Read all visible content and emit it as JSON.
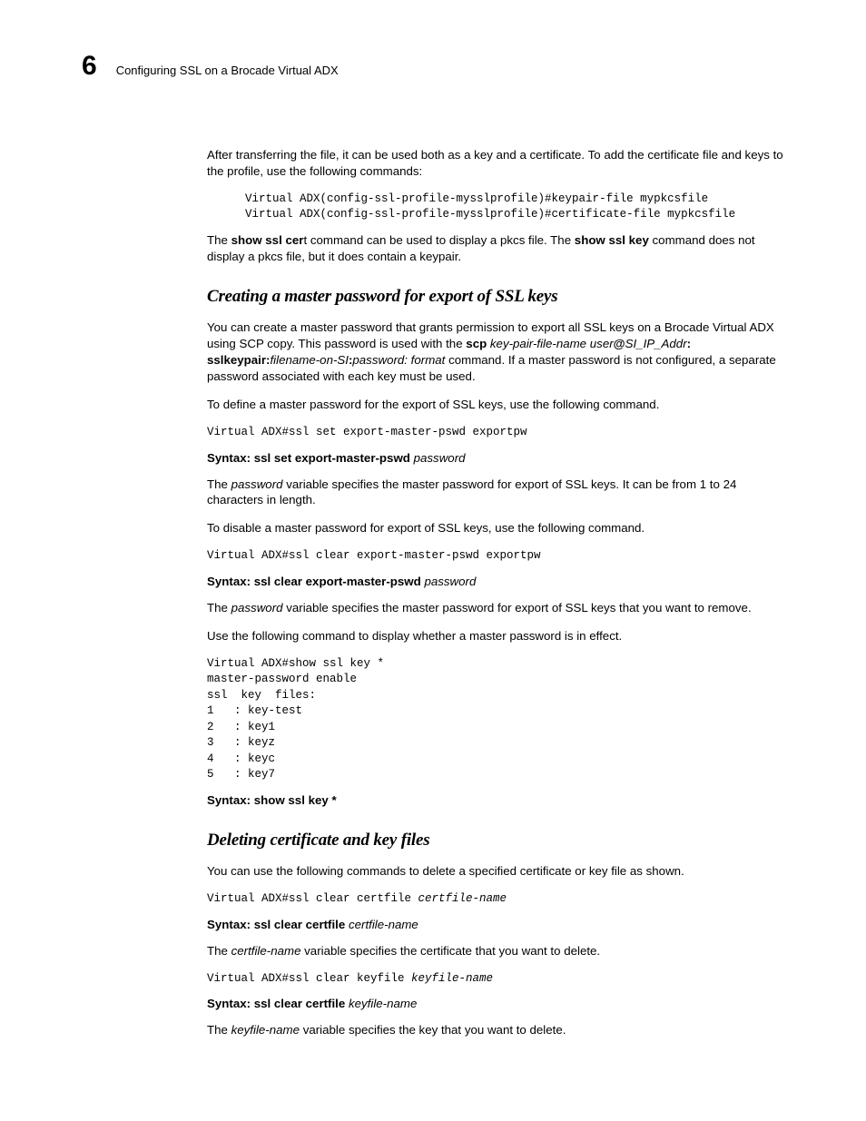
{
  "header": {
    "chapter_num": "6",
    "title": "Configuring SSL on a Brocade Virtual ADX"
  },
  "sec0": {
    "p1": "After transferring the file, it can be used both as a key and a certificate. To add the certificate file and keys to the profile, use the following commands:",
    "code1": "Virtual ADX(config-ssl-profile-mysslprofile)#keypair-file mypkcsfile\nVirtual ADX(config-ssl-profile-mysslprofile)#certificate-file mypkcsfile",
    "p2_a": "The ",
    "p2_b": "show ssl cer",
    "p2_c": "t command can be used to display a pkcs file. The ",
    "p2_d": "show ssl key",
    "p2_e": " command does not display a pkcs file, but it does contain a keypair."
  },
  "sec1": {
    "heading": "Creating a master password for export of SSL keys",
    "p1_a": "You can create a master password that grants permission to export all SSL keys on a Brocade Virtual ADX using SCP copy. This password is used with the ",
    "p1_b": "scp",
    "p1_c": " key-pair-file-name user",
    "p1_d": "@",
    "p1_e": "SI_IP_Addr",
    "p1_f": ": sslkeypair:",
    "p1_g": "filename-on-SI",
    "p1_h": ":",
    "p1_i": "password: format",
    "p1_j": " command. If a master password is not configured, a separate password associated with each key must be used.",
    "p2": "To define a master password for the export of SSL keys, use the following command.",
    "code1": "Virtual ADX#ssl set export-master-pswd exportpw",
    "syn1_lbl": "Syntax:  ",
    "syn1_cmd": "ssl set export-master-pswd",
    "syn1_arg": " password",
    "p3_a": "The ",
    "p3_b": "password",
    "p3_c": " variable specifies the master password for export of SSL keys. It can be from 1 to 24 characters in length.",
    "p4": "To disable a master password for export of SSL keys, use the following command.",
    "code2": "Virtual ADX#ssl clear export-master-pswd exportpw",
    "syn2_lbl": "Syntax:  ",
    "syn2_cmd": "ssl clear export-master-pswd",
    "syn2_arg": " password",
    "p5_a": "The ",
    "p5_b": "password",
    "p5_c": " variable specifies the master password for export of SSL keys that you want to remove.",
    "p6": "Use the following command to display whether a master password is in effect.",
    "code3": "Virtual ADX#show ssl key *\nmaster-password enable\nssl  key  files:\n1   : key-test\n2   : key1\n3   : keyz\n4   : keyc\n5   : key7",
    "syn3_lbl": "Syntax:  ",
    "syn3_cmd": "show ssl key *"
  },
  "sec2": {
    "heading": "Deleting certificate and key files",
    "p1": "You can use the following commands to delete a specified certificate or key file as shown.",
    "code1_a": "Virtual ADX#ssl clear certfile ",
    "code1_b": "certfile-name",
    "syn1_lbl": "Syntax:  ",
    "syn1_cmd": "ssl clear certfile",
    "syn1_arg": " certfile-name",
    "p2_a": "The ",
    "p2_b": "certfile-name",
    "p2_c": " variable specifies the certificate that you want to delete.",
    "code2_a": "Virtual ADX#ssl clear keyfile ",
    "code2_b": "keyfile-name",
    "syn2_lbl": "Syntax:  ",
    "syn2_cmd": "ssl clear certfile",
    "syn2_arg": " keyfile-name",
    "p3_a": "The ",
    "p3_b": "keyfile-name",
    "p3_c": " variable specifies the key that you want to delete."
  }
}
